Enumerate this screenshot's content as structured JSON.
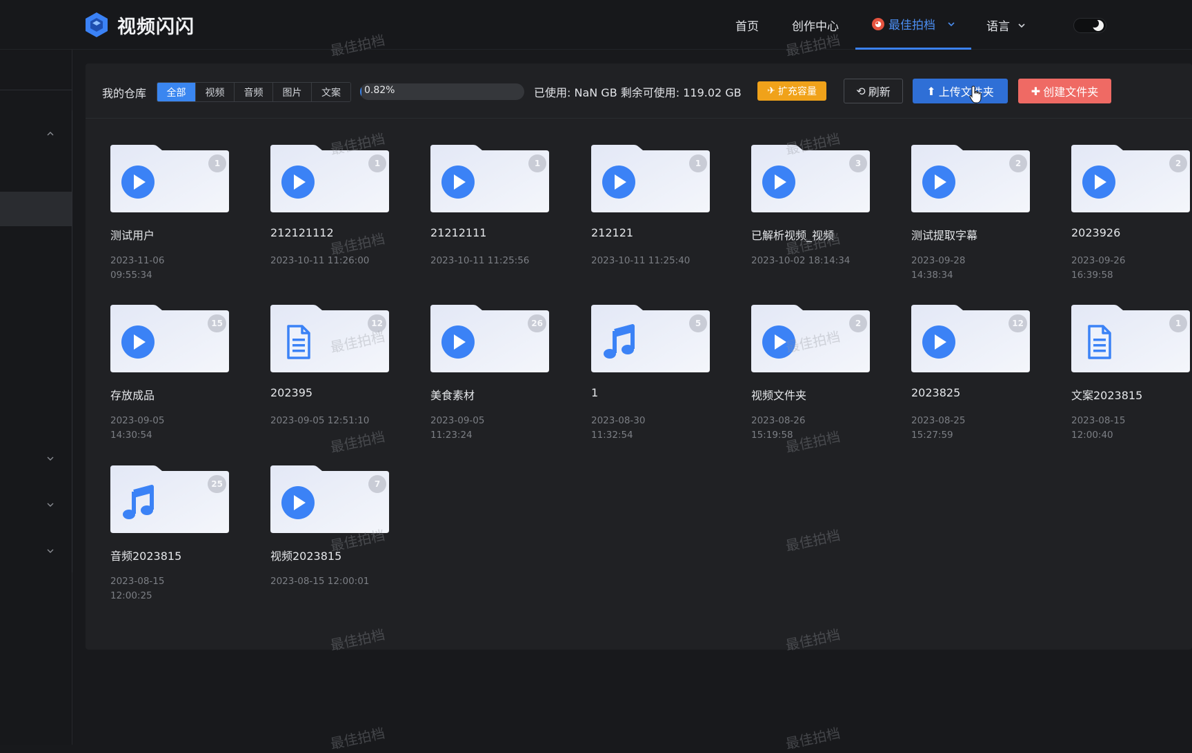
{
  "app": {
    "title": "视频闪闪"
  },
  "nav": {
    "home": "首页",
    "create_center": "创作中心",
    "user": "最佳拍档",
    "language": "语言"
  },
  "toolbar": {
    "repo_label": "我的仓库",
    "filters": [
      "全部",
      "视频",
      "音频",
      "图片",
      "文案"
    ],
    "active_filter": "全部",
    "progress_percent": 0.82,
    "progress_label": "0.82%",
    "usage_text": "已使用: NaN GB 剩余可使用: 119.02 GB",
    "expand_button": "扩充容量",
    "refresh_button": "刷新",
    "upload_button": "上传文件夹",
    "create_button": "创建文件夹"
  },
  "watermark": "最佳拍档",
  "folders": [
    {
      "name": "测试用户",
      "date": "2023-11-06\n09:55:34",
      "count": "1",
      "icon": "play-icon"
    },
    {
      "name": "212121112",
      "date": "2023-10-11 11:26:00",
      "count": "1",
      "icon": "play-icon"
    },
    {
      "name": "21212111",
      "date": "2023-10-11 11:25:56",
      "count": "1",
      "icon": "play-icon"
    },
    {
      "name": "212121",
      "date": "2023-10-11 11:25:40",
      "count": "1",
      "icon": "play-icon"
    },
    {
      "name": "已解析视频_视频",
      "date": "2023-10-02 18:14:34",
      "count": "3",
      "icon": "play-icon"
    },
    {
      "name": "测试提取字幕",
      "date": "2023-09-28\n14:38:34",
      "count": "2",
      "icon": "play-icon"
    },
    {
      "name": "2023926",
      "date": "2023-09-26\n16:39:58",
      "count": "2",
      "icon": "play-icon"
    },
    {
      "name": "存放成品",
      "date": "2023-09-05\n14:30:54",
      "count": "15",
      "icon": "play-icon"
    },
    {
      "name": "202395",
      "date": "2023-09-05 12:51:10",
      "count": "12",
      "icon": "document-icon"
    },
    {
      "name": "美食素材",
      "date": "2023-09-05\n11:23:24",
      "count": "26",
      "icon": "play-icon"
    },
    {
      "name": "1",
      "date": "2023-08-30\n11:32:54",
      "count": "5",
      "icon": "music-icon"
    },
    {
      "name": "视频文件夹",
      "date": "2023-08-26\n15:19:58",
      "count": "2",
      "icon": "play-icon"
    },
    {
      "name": "2023825",
      "date": "2023-08-25\n15:27:59",
      "count": "12",
      "icon": "play-icon"
    },
    {
      "name": "文案2023815",
      "date": "2023-08-15\n12:00:40",
      "count": "1",
      "icon": "document-icon"
    },
    {
      "name": "音频2023815",
      "date": "2023-08-15\n12:00:25",
      "count": "25",
      "icon": "music-icon"
    },
    {
      "name": "视频2023815",
      "date": "2023-08-15 12:00:01",
      "count": "7",
      "icon": "play-icon"
    }
  ]
}
